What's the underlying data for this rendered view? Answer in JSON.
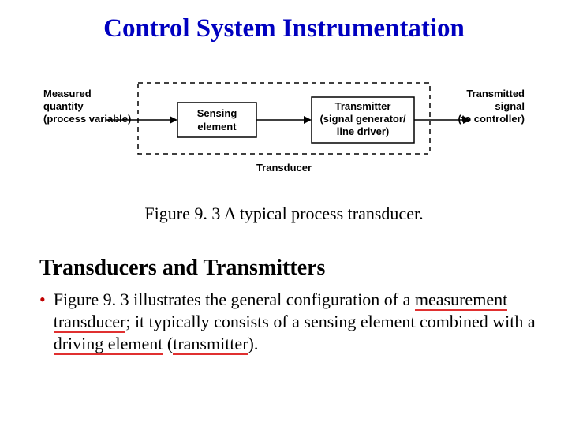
{
  "title": "Control System Instrumentation",
  "diagram": {
    "input_top": "Measured",
    "input_mid": "quantity",
    "input_bot": "(process variable)",
    "sensing_top": "Sensing",
    "sensing_bot": "element",
    "transmitter_top": "Transmitter",
    "transmitter_mid": "(signal generator/",
    "transmitter_bot": "line driver)",
    "output_top": "Transmitted",
    "output_mid": "signal",
    "output_bot": "(to controller)",
    "transducer_label": "Transducer"
  },
  "caption": "Figure 9. 3 A typical process transducer.",
  "section_title": "Transducers and Transmitters",
  "bullet": {
    "t1": "Figure 9. 3 illustrates the general configuration of a ",
    "u1": "measurement",
    "t2": " ",
    "u2": "transducer",
    "t3": "; it typically consists of a sensing element combined with a ",
    "u3": "driving element",
    "t4": " (",
    "u4": "transmitter",
    "t5": ")."
  }
}
